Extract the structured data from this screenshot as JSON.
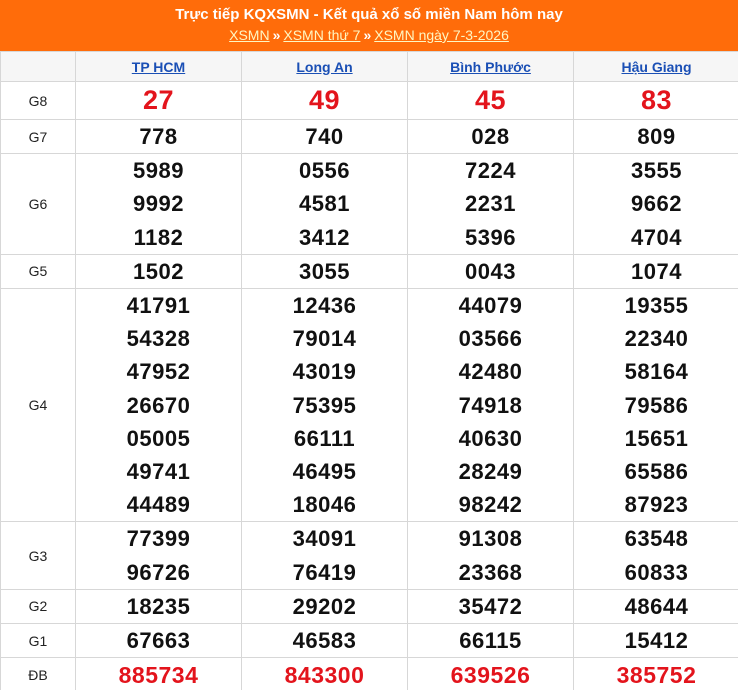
{
  "header": {
    "title": "Trực tiếp KQXSMN - Kết quả xổ số miền Nam hôm nay",
    "breadcrumbs": [
      "XSMN",
      "XSMN thứ 7",
      "XSMN ngày 7-3-2026"
    ],
    "separator": "»",
    "background_color": "#ff6c0a"
  },
  "table": {
    "provinces": [
      "TP HCM",
      "Long An",
      "Bình Phước",
      "Hậu Giang"
    ],
    "rows": [
      {
        "label": "G8",
        "values": [
          [
            "27"
          ],
          [
            "49"
          ],
          [
            "45"
          ],
          [
            "83"
          ]
        ]
      },
      {
        "label": "G7",
        "values": [
          [
            "778"
          ],
          [
            "740"
          ],
          [
            "028"
          ],
          [
            "809"
          ]
        ]
      },
      {
        "label": "G6",
        "values": [
          [
            "5989",
            "9992",
            "1182"
          ],
          [
            "0556",
            "4581",
            "3412"
          ],
          [
            "7224",
            "2231",
            "5396"
          ],
          [
            "3555",
            "9662",
            "4704"
          ]
        ]
      },
      {
        "label": "G5",
        "values": [
          [
            "1502"
          ],
          [
            "3055"
          ],
          [
            "0043"
          ],
          [
            "1074"
          ]
        ]
      },
      {
        "label": "G4",
        "values": [
          [
            "41791",
            "54328",
            "47952",
            "26670",
            "05005",
            "49741",
            "44489"
          ],
          [
            "12436",
            "79014",
            "43019",
            "75395",
            "66111",
            "46495",
            "18046"
          ],
          [
            "44079",
            "03566",
            "42480",
            "74918",
            "40630",
            "28249",
            "98242"
          ],
          [
            "19355",
            "22340",
            "58164",
            "79586",
            "15651",
            "65586",
            "87923"
          ]
        ]
      },
      {
        "label": "G3",
        "values": [
          [
            "77399",
            "96726"
          ],
          [
            "34091",
            "76419"
          ],
          [
            "91308",
            "23368"
          ],
          [
            "63548",
            "60833"
          ]
        ]
      },
      {
        "label": "G2",
        "values": [
          [
            "18235"
          ],
          [
            "29202"
          ],
          [
            "35472"
          ],
          [
            "48644"
          ]
        ]
      },
      {
        "label": "G1",
        "values": [
          [
            "67663"
          ],
          [
            "46583"
          ],
          [
            "66115"
          ],
          [
            "15412"
          ]
        ]
      },
      {
        "label": "ĐB",
        "values": [
          [
            "885734"
          ],
          [
            "843300"
          ],
          [
            "639526"
          ],
          [
            "385752"
          ]
        ]
      }
    ],
    "highlight_color": "#e3141c",
    "link_color": "#1a4fb5"
  }
}
